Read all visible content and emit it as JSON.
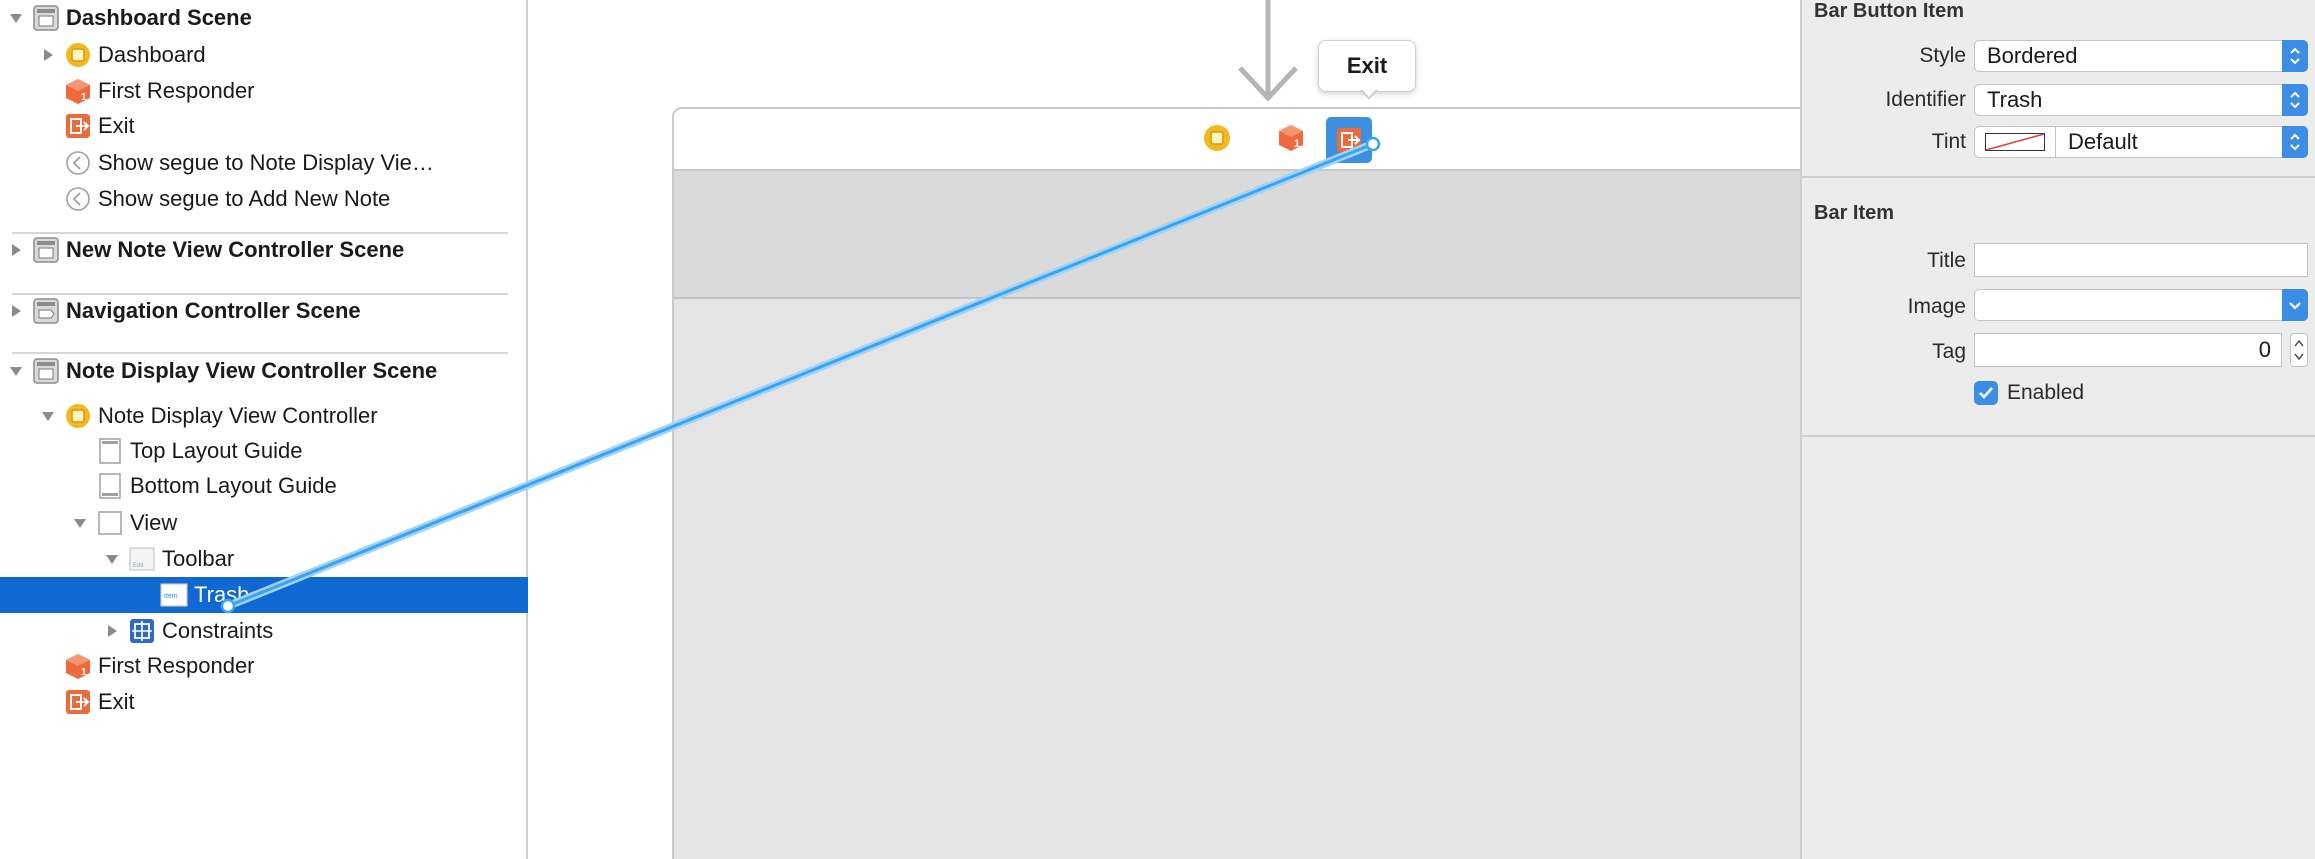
{
  "outline": {
    "rows": [
      {
        "label": "Dashboard Scene",
        "icon": "scene-icon",
        "disclosure": "expanded",
        "indent": 0,
        "bold": true
      },
      {
        "label": "Dashboard",
        "icon": "view-controller-icon",
        "disclosure": "collapsed",
        "indent": 1,
        "bold": false
      },
      {
        "label": "First Responder",
        "icon": "first-responder-icon",
        "disclosure": "none",
        "indent": 1,
        "bold": false
      },
      {
        "label": "Exit",
        "icon": "exit-icon",
        "disclosure": "none",
        "indent": 1,
        "bold": false
      },
      {
        "label": "Show segue to Note Display Vie…",
        "icon": "segue-icon",
        "disclosure": "none",
        "indent": 1,
        "bold": false
      },
      {
        "label": "Show segue to Add New Note",
        "icon": "segue-icon",
        "disclosure": "none",
        "indent": 1,
        "bold": false
      },
      {
        "label": "New Note View Controller Scene",
        "icon": "scene-icon",
        "disclosure": "collapsed",
        "indent": 0,
        "bold": true
      },
      {
        "label": "Navigation Controller Scene",
        "icon": "nav-scene-icon",
        "disclosure": "collapsed",
        "indent": 0,
        "bold": true
      },
      {
        "label": "Note Display View Controller Scene",
        "icon": "scene-icon",
        "disclosure": "expanded",
        "indent": 0,
        "bold": true
      },
      {
        "label": "Note Display View Controller",
        "icon": "view-controller-icon",
        "disclosure": "expanded",
        "indent": 1,
        "bold": false
      },
      {
        "label": "Top Layout Guide",
        "icon": "top-layout-guide-icon",
        "disclosure": "none",
        "indent": 2,
        "bold": false
      },
      {
        "label": "Bottom Layout Guide",
        "icon": "bottom-layout-guide-icon",
        "disclosure": "none",
        "indent": 2,
        "bold": false
      },
      {
        "label": "View",
        "icon": "view-icon",
        "disclosure": "expanded",
        "indent": 2,
        "bold": false
      },
      {
        "label": "Toolbar",
        "icon": "toolbar-icon",
        "disclosure": "expanded",
        "indent": 3,
        "bold": false
      },
      {
        "label": "Trash",
        "icon": "bar-button-item-icon",
        "disclosure": "none",
        "indent": 4,
        "bold": false,
        "selected": true
      },
      {
        "label": "Constraints",
        "icon": "constraints-icon",
        "disclosure": "collapsed",
        "indent": 3,
        "bold": false
      },
      {
        "label": "First Responder",
        "icon": "first-responder-icon",
        "disclosure": "none",
        "indent": 1,
        "bold": false
      },
      {
        "label": "Exit",
        "icon": "exit-icon",
        "disclosure": "none",
        "indent": 1,
        "bold": false
      }
    ]
  },
  "canvas": {
    "tooltip": "Exit",
    "dock_icons": [
      "view-controller-icon",
      "first-responder-icon",
      "exit-icon"
    ],
    "connection_color": "#3ba3f0"
  },
  "inspector": {
    "bar_button_item": {
      "title": "Bar Button Item",
      "style_label": "Style",
      "style_value": "Bordered",
      "identifier_label": "Identifier",
      "identifier_value": "Trash",
      "tint_label": "Tint",
      "tint_value": "Default"
    },
    "bar_item": {
      "title": "Bar Item",
      "title_label": "Title",
      "title_value": "",
      "image_label": "Image",
      "image_value": "",
      "tag_label": "Tag",
      "tag_value": "0",
      "enabled_label": "Enabled",
      "enabled_checked": true
    }
  },
  "colors": {
    "selection": "#1069d3",
    "accent": "#3b8ee4",
    "exit_orange": "#ee6a3c",
    "vc_yellow": "#f1b821"
  }
}
